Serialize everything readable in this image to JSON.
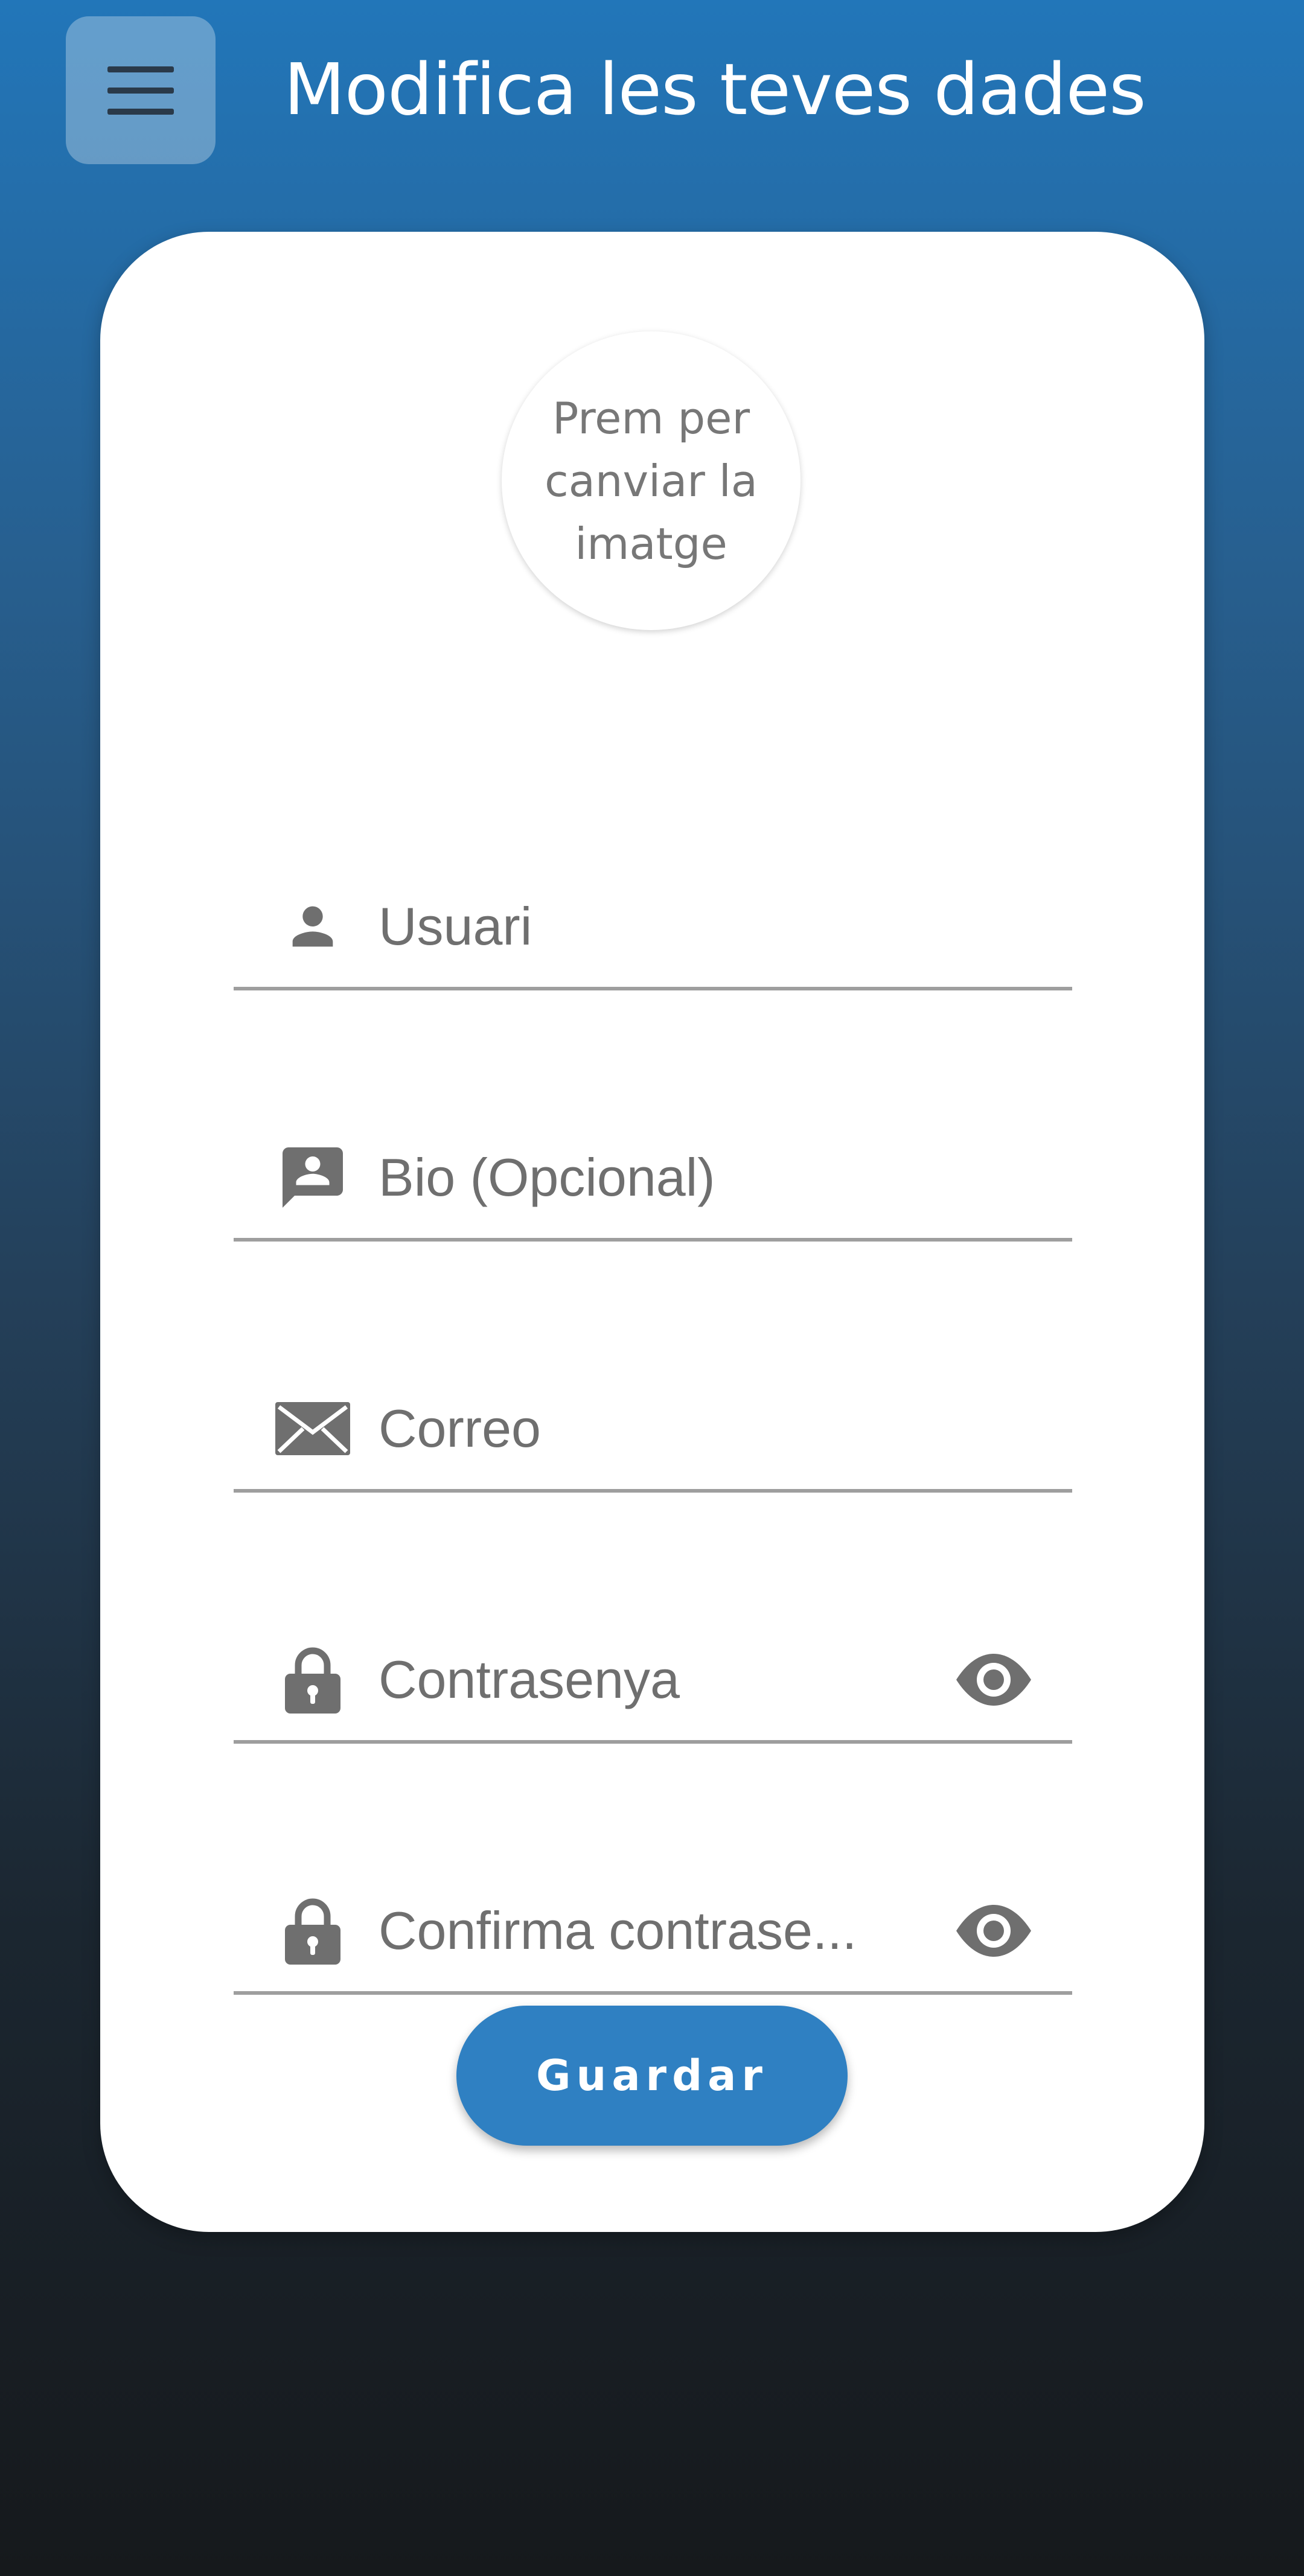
{
  "header": {
    "menu_icon": "hamburger-menu-icon",
    "title": "Modifica les teves dades"
  },
  "avatar": {
    "label": "Prem per canviar la imatge"
  },
  "form": {
    "fields": [
      {
        "icon": "person-icon",
        "placeholder": "Usuari",
        "value": ""
      },
      {
        "icon": "contact-bubble-icon",
        "placeholder": "Bio (Opcional)",
        "value": ""
      },
      {
        "icon": "envelope-icon",
        "placeholder": "Correo",
        "value": ""
      },
      {
        "icon": "lock-icon",
        "placeholder": "Contrasenya",
        "value": "",
        "trailing_icon": "eye-icon"
      },
      {
        "icon": "lock-icon",
        "placeholder": "Confirma contrase...",
        "value": "",
        "trailing_icon": "eye-icon"
      }
    ],
    "submit_label": "Guardar"
  },
  "colors": {
    "gradient_top": "#2276b9",
    "gradient_bottom": "#16191c",
    "button": "#2f80c2",
    "icon": "#6f6f6f",
    "card": "#ffffff"
  }
}
